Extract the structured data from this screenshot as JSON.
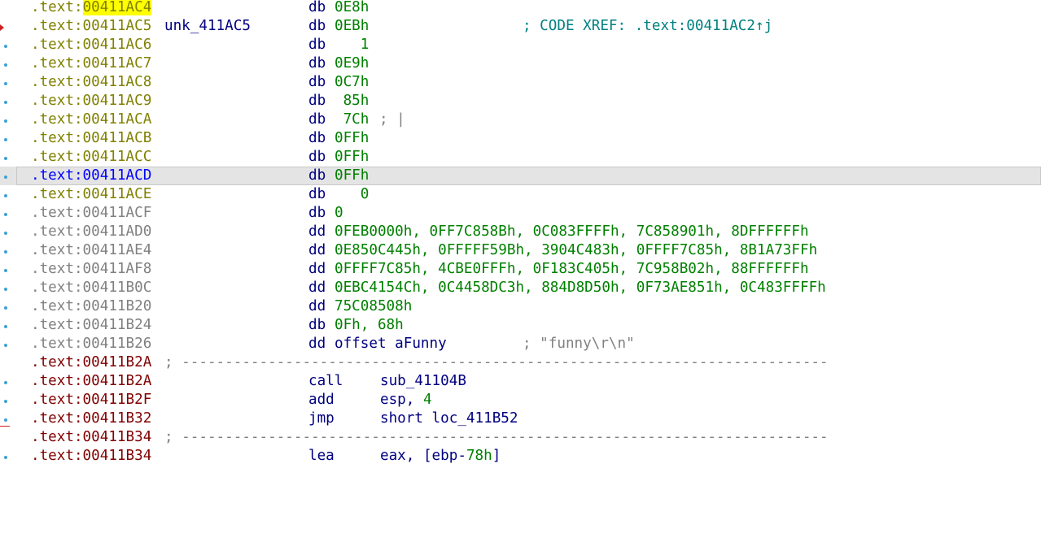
{
  "lines": [
    {
      "addr": ".text:",
      "addr_hl": "00411AC4",
      "label": "",
      "mn": "db",
      "ops": "0E8h",
      "cmt": ""
    },
    {
      "addr": ".text:00411AC5",
      "label": "unk_411AC5",
      "mn": "db",
      "ops": "0EBh",
      "cmt": "; CODE XREF: .text:00411AC2↑j"
    },
    {
      "addr": ".text:00411AC6",
      "mn": "db",
      "ops": "   1"
    },
    {
      "addr": ".text:00411AC7",
      "mn": "db",
      "ops": "0E9h"
    },
    {
      "addr": ".text:00411AC8",
      "mn": "db",
      "ops": "0C7h"
    },
    {
      "addr": ".text:00411AC9",
      "mn": "db",
      "ops": " 85h"
    },
    {
      "addr": ".text:00411ACA",
      "mn": "db",
      "ops": " 7Ch",
      "cmt": "; |"
    },
    {
      "addr": ".text:00411ACB",
      "mn": "db",
      "ops": "0FFh"
    },
    {
      "addr": ".text:00411ACC",
      "mn": "db",
      "ops": "0FFh"
    },
    {
      "addr": ".text:00411ACD",
      "mn": "db",
      "ops": "0FFh"
    },
    {
      "addr": ".text:00411ACE",
      "mn": "db",
      "ops": "   0"
    },
    {
      "addr": ".text:00411ACF",
      "mn": "db",
      "ops": "0"
    },
    {
      "addr": ".text:00411AD0",
      "mn": "dd",
      "ops": "0FEB0000h, 0FF7C858Bh, 0C083FFFFh, 7C858901h, 8DFFFFFFh"
    },
    {
      "addr": ".text:00411AE4",
      "mn": "dd",
      "ops": "0E850C445h, 0FFFFF59Bh, 3904C483h, 0FFFF7C85h, 8B1A73FFh"
    },
    {
      "addr": ".text:00411AF8",
      "mn": "dd",
      "ops": "0FFFF7C85h, 4CBE0FFFh, 0F183C405h, 7C958B02h, 88FFFFFFh"
    },
    {
      "addr": ".text:00411B0C",
      "mn": "dd",
      "ops": "0EBC4154Ch, 0C4458DC3h, 884D8D50h, 0F73AE851h, 0C483FFFFh"
    },
    {
      "addr": ".text:00411B20",
      "mn": "dd",
      "ops": "75C08508h"
    },
    {
      "addr": ".text:00411B24",
      "mn": "db",
      "ops": "0Fh, 68h"
    },
    {
      "addr": ".text:00411B26",
      "mn": "dd",
      "ops_kw": "offset",
      "ops_sym": "aFunny",
      "cmt": "; \"funny\\r\\n\""
    },
    {
      "addr": ".text:00411B2A",
      "sep": "; ---------------------------------------------------------------------------"
    },
    {
      "addr": ".text:00411B2A",
      "mn": "call",
      "ops": "sub_41104B"
    },
    {
      "addr": ".text:00411B2F",
      "mn": "add",
      "ops_reg": "esp,",
      "ops_num": "4"
    },
    {
      "addr": ".text:00411B32",
      "mn": "jmp",
      "ops": "short loc_411B52"
    },
    {
      "addr": ".text:00411B34",
      "sep": "; ---------------------------------------------------------------------------"
    },
    {
      "addr": ".text:00411B34",
      "mn": "lea",
      "ops_reg": "eax,",
      "ops_mem_a": "[ebp-",
      "ops_mem_b": "78h",
      "ops_mem_c": "]"
    }
  ],
  "colors": {
    "address_data": "#808000",
    "address_unexplored": "#808080",
    "address_code": "#800000",
    "address_selected": "#0000ff",
    "highlight": "#ffff00",
    "mnemonic": "#000080",
    "operand_number": "#008000",
    "comment": "#008080",
    "selection_bg": "#e4e4e4"
  }
}
